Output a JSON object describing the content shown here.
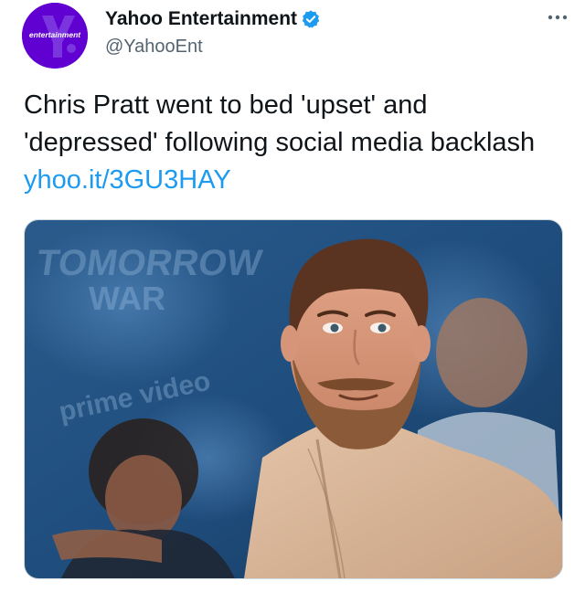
{
  "author": {
    "display_name": "Yahoo Entertainment",
    "handle": "@YahooEnt",
    "verified": true,
    "avatar_logo_text": "entertainment"
  },
  "tweet": {
    "text": "Chris Pratt went to bed 'upset' and 'depressed' following social media backlash ",
    "link": "yhoo.it/3GU3HAY"
  },
  "media": {
    "backdrop_lettering": [
      "TOMORROW",
      "WAR",
      "prime video"
    ]
  },
  "icons": {
    "verified": "verified-badge-icon",
    "more": "more-options-icon"
  },
  "colors": {
    "link": "#1d9bf0",
    "verified": "#1d9bf0",
    "avatar_bg": "#6001d2",
    "handle": "#536471"
  }
}
